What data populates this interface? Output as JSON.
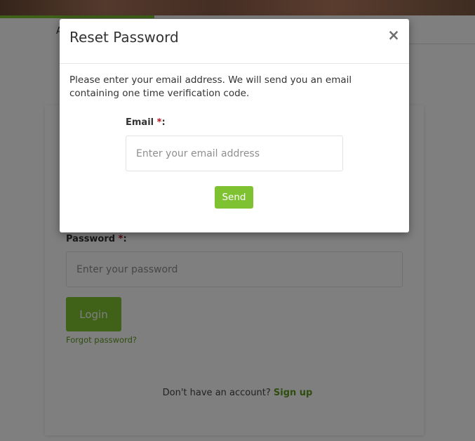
{
  "background": {
    "breadcrumb_fragment": "A",
    "password_label": "Password",
    "required_marker": "*",
    "label_colon": ":",
    "password_placeholder": "Enter your password",
    "login_label": "Login",
    "forgot_label": "Forgot password?",
    "signup_prompt": "Don't have an account?",
    "signup_label": "Sign up"
  },
  "modal": {
    "title": "Reset Password",
    "close_symbol": "×",
    "body_text": "Please enter your email address. We will send you an email containing one time verification code.",
    "email_label": "Email",
    "required_marker": "*",
    "label_colon": ":",
    "email_placeholder": "Enter your email address",
    "email_value": "",
    "send_label": "Send"
  },
  "colors": {
    "accent": "#7fc231",
    "link": "#5f9b1f",
    "required": "#b3121b",
    "overlay": "rgba(0,0,0,0.5)"
  }
}
